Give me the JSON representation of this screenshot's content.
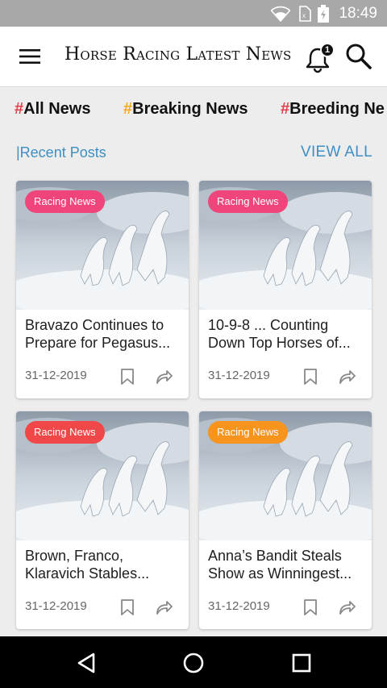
{
  "status_bar": {
    "time": "18:49",
    "icons": [
      "wifi-icon",
      "sim-icon",
      "battery-icon"
    ]
  },
  "app_bar": {
    "title": "Horse Racing Latest News",
    "notification_count": "1",
    "icons": [
      "hamburger-menu-icon",
      "bell-icon",
      "search-icon"
    ]
  },
  "categories": [
    {
      "hash": "#",
      "label": "All News"
    },
    {
      "hash": "#",
      "label": "Breaking News"
    },
    {
      "hash": "#",
      "label": "Breeding Ne"
    }
  ],
  "section": {
    "title": "|Recent Posts",
    "view_all": "VIEW ALL"
  },
  "posts": [
    {
      "badge": "Racing News",
      "title": "Bravazo Continues to Prepare for Pegasus...",
      "date": "31-12-2019",
      "badge_color": "#f0457a"
    },
    {
      "badge": "Racing News",
      "title": "10-9-8 ... Counting Down Top Horses of...",
      "date": "31-12-2019",
      "badge_color": "#f0457a"
    },
    {
      "badge": "Racing News",
      "title": "Brown, Franco, Klaravich Stables...",
      "date": "31-12-2019",
      "badge_color": "#f04848"
    },
    {
      "badge": "Racing News",
      "title": "Anna’s Bandit Steals Show as Winningest...",
      "date": "31-12-2019",
      "badge_color": "#f7941d"
    }
  ],
  "colors": {
    "accent_blue": "#3d8fc4",
    "hash_red": "#e0404a",
    "hash_orange": "#f5a623",
    "status_bar": "#a8a8a8"
  },
  "nav_bar": {
    "icons": [
      "back-icon",
      "home-icon",
      "recents-icon"
    ]
  }
}
